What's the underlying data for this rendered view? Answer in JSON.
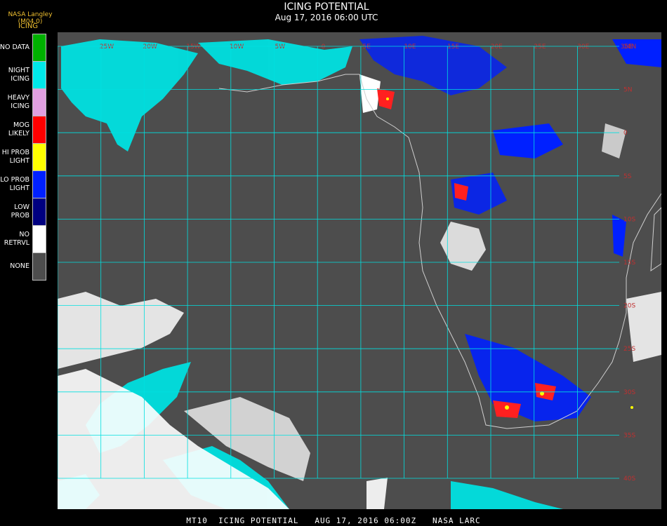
{
  "header": {
    "title": "ICING POTENTIAL",
    "subtitle": "Aug 17, 2016 06:00 UTC",
    "producer": "NASA Langley (M04.0)"
  },
  "legend": {
    "title": "ICING",
    "items": [
      {
        "label": "NO DATA",
        "color": "#00b000"
      },
      {
        "label": "NIGHT\nICING",
        "color": "#00e8e8"
      },
      {
        "label": "HEAVY\nICING",
        "color": "#e0a0e0"
      },
      {
        "label": "MOG\nLIKELY",
        "color": "#ff0000"
      },
      {
        "label": "HI PROB\nLIGHT",
        "color": "#ffff00"
      },
      {
        "label": "LO PROB\nLIGHT",
        "color": "#0020ff"
      },
      {
        "label": "LOW\nPROB",
        "color": "#000080"
      },
      {
        "label": "NO\nRETRVL",
        "color": "#ffffff"
      },
      {
        "label": "NONE",
        "color": "#4d4d4d"
      }
    ]
  },
  "map": {
    "background_color": "#4d4d4d",
    "grid_color": "#00e0e0",
    "coastline_color": "#d0d0d0",
    "grid_label_color": "#c03030",
    "longitude_labels": [
      "25W",
      "20W",
      "15W",
      "10W",
      "5W",
      "0",
      "5E",
      "10E",
      "15E",
      "20E",
      "25E",
      "30E",
      "35E"
    ],
    "latitude_labels": [
      "10N",
      "5N",
      "0",
      "5S",
      "10S",
      "15S",
      "20S",
      "25S",
      "30S",
      "35S",
      "40S"
    ]
  },
  "footer": "MT10  ICING POTENTIAL   AUG 17, 2016 06:00Z   NASA LARC"
}
